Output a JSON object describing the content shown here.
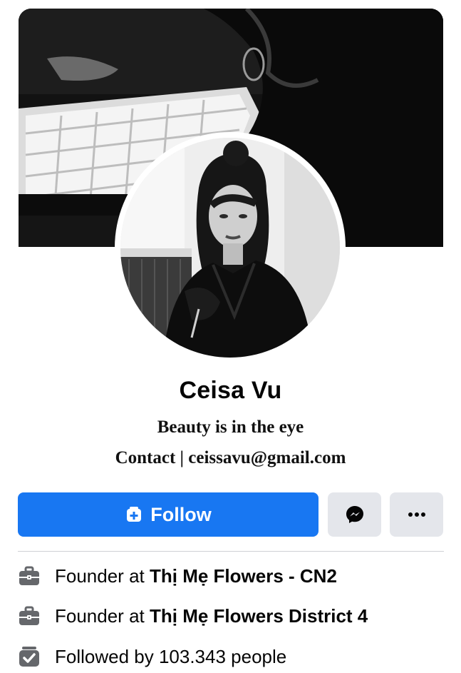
{
  "profile": {
    "name": "Ceisa Vu",
    "bio_line1": "Beauty is in the eye",
    "bio_line2": "Contact | ceissavu@gmail.com"
  },
  "actions": {
    "follow_label": "Follow",
    "messenger_icon": "messenger-icon",
    "more_icon": "more-dots-icon"
  },
  "details": [
    {
      "icon": "briefcase-icon",
      "prefix": "Founder at ",
      "value": "Thị Mẹ Flowers - CN2"
    },
    {
      "icon": "briefcase-icon",
      "prefix": "Founder at ",
      "value": "Thị Mẹ Flowers District 4"
    },
    {
      "icon": "followers-check-icon",
      "prefix": "Followed by 103.343 people",
      "value": ""
    }
  ],
  "colors": {
    "accent": "#1877f2",
    "secondary_button": "#e4e6eb",
    "text": "#050505",
    "divider": "#ced0d4"
  }
}
